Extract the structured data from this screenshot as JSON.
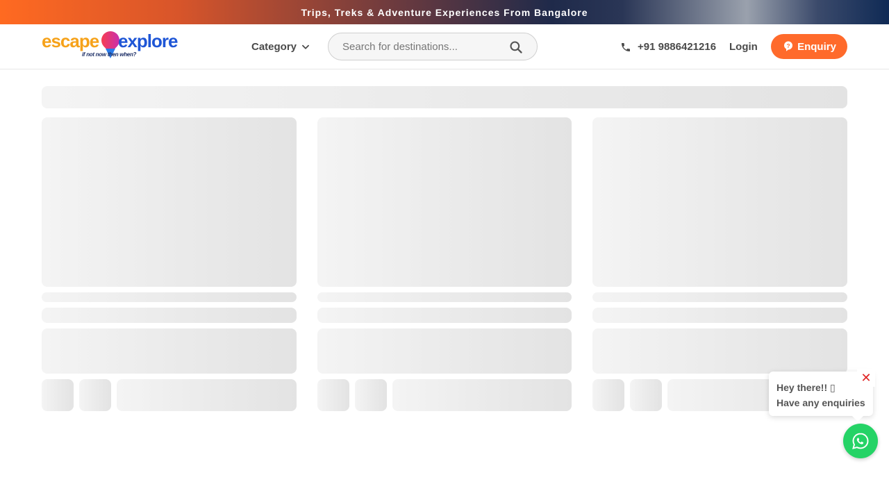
{
  "banner": {
    "text": "Trips, Treks & Adventure Experiences From Bangalore"
  },
  "logo": {
    "word1": "escape",
    "word2": "explore",
    "tagline": "if not now then when?"
  },
  "nav": {
    "category_label": "Category"
  },
  "search": {
    "placeholder": "Search for destinations..."
  },
  "contact": {
    "phone": "+91 9886421216"
  },
  "auth": {
    "login_label": "Login"
  },
  "cta": {
    "enquiry_label": "Enquiry"
  },
  "chat": {
    "line1": "Hey there!! ▯",
    "line2": "Have any enquiries",
    "close": "✕"
  },
  "colors": {
    "accent": "#ff6a2b",
    "whatsapp": "#25d366",
    "close": "#e02424"
  }
}
